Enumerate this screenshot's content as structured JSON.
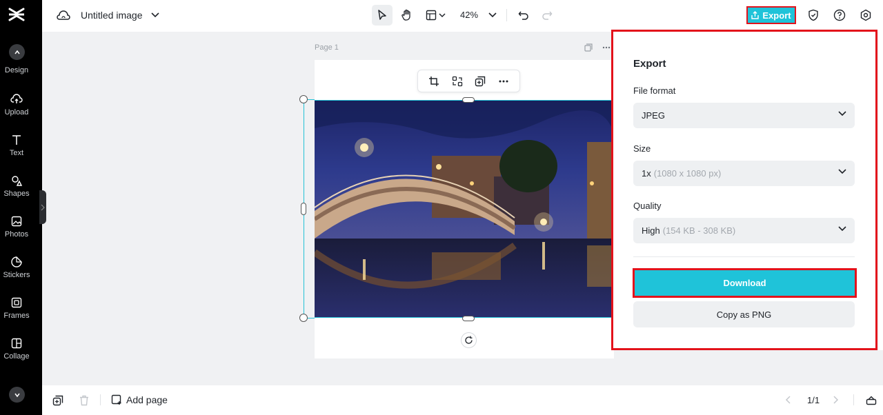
{
  "app": {
    "document_title": "Untitled image",
    "zoom": "42%"
  },
  "sidebar": {
    "items": [
      {
        "label": "Design",
        "icon": "design-icon"
      },
      {
        "label": "Upload",
        "icon": "upload-cloud-icon"
      },
      {
        "label": "Text",
        "icon": "text-icon"
      },
      {
        "label": "Shapes",
        "icon": "shapes-icon"
      },
      {
        "label": "Photos",
        "icon": "photos-icon"
      },
      {
        "label": "Stickers",
        "icon": "stickers-icon"
      },
      {
        "label": "Frames",
        "icon": "frames-icon"
      },
      {
        "label": "Collage",
        "icon": "collage-icon"
      }
    ]
  },
  "toolbar": {
    "export_label": "Export"
  },
  "canvas": {
    "page_label": "Page 1"
  },
  "export_panel": {
    "title": "Export",
    "file_format_label": "File format",
    "file_format_value": "JPEG",
    "size_label": "Size",
    "size_value": "1x",
    "size_detail": "(1080 x 1080 px)",
    "quality_label": "Quality",
    "quality_value": "High",
    "quality_detail": "(154 KB - 308 KB)",
    "download_label": "Download",
    "copy_label": "Copy as PNG"
  },
  "bottom": {
    "add_page_label": "Add page",
    "page_count": "1/1"
  },
  "colors": {
    "accent": "#1fc3d9",
    "highlight_border": "#e3121b",
    "sidebar_bg": "#000000"
  }
}
